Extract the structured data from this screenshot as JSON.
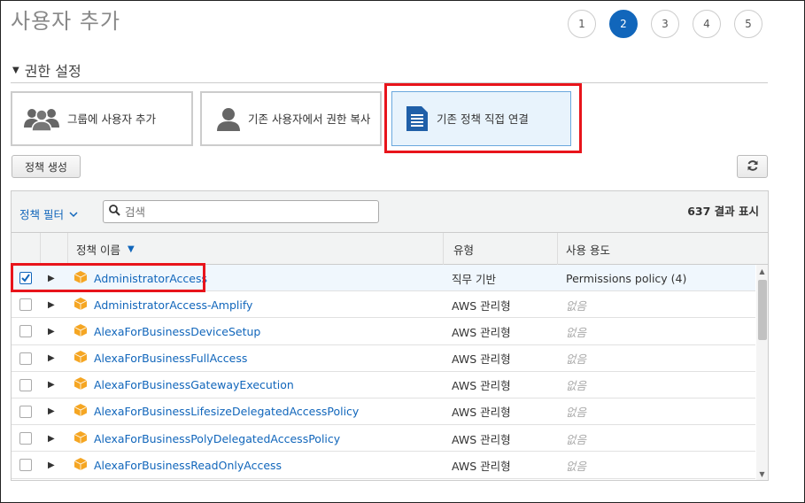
{
  "header": {
    "title": "사용자 추가",
    "steps": [
      "1",
      "2",
      "3",
      "4",
      "5"
    ]
  },
  "section": {
    "title": "권한 설정"
  },
  "options": [
    {
      "label": "그룹에 사용자 추가",
      "icon": "group-icon"
    },
    {
      "label": "기존 사용자에서 권한 복사",
      "icon": "user-icon"
    },
    {
      "label": "기존 정책 직접 연결",
      "icon": "document-icon"
    }
  ],
  "toolbar": {
    "create_policy_label": "정책 생성",
    "refresh_icon": "refresh-icon"
  },
  "filter": {
    "label": "정책 필터",
    "search_placeholder": "검색",
    "result_count": "637 결과 표시"
  },
  "table": {
    "headers": {
      "name": "정책 이름",
      "type": "유형",
      "usage": "사용 용도"
    },
    "rows": [
      {
        "name": "AdministratorAccess",
        "type": "직무 기반",
        "usage": "Permissions policy (4)",
        "checked": true
      },
      {
        "name": "AdministratorAccess-Amplify",
        "type": "AWS 관리형",
        "usage": "없음",
        "checked": false
      },
      {
        "name": "AlexaForBusinessDeviceSetup",
        "type": "AWS 관리형",
        "usage": "없음",
        "checked": false
      },
      {
        "name": "AlexaForBusinessFullAccess",
        "type": "AWS 관리형",
        "usage": "없음",
        "checked": false
      },
      {
        "name": "AlexaForBusinessGatewayExecution",
        "type": "AWS 관리형",
        "usage": "없음",
        "checked": false
      },
      {
        "name": "AlexaForBusinessLifesizeDelegatedAccessPolicy",
        "type": "AWS 관리형",
        "usage": "없음",
        "checked": false
      },
      {
        "name": "AlexaForBusinessPolyDelegatedAccessPolicy",
        "type": "AWS 관리형",
        "usage": "없음",
        "checked": false
      },
      {
        "name": "AlexaForBusinessReadOnlyAccess",
        "type": "AWS 관리형",
        "usage": "없음",
        "checked": false
      }
    ]
  },
  "colors": {
    "accent": "#1166bb",
    "highlight": "#e8141b",
    "policy_icon": "#f5a623"
  }
}
